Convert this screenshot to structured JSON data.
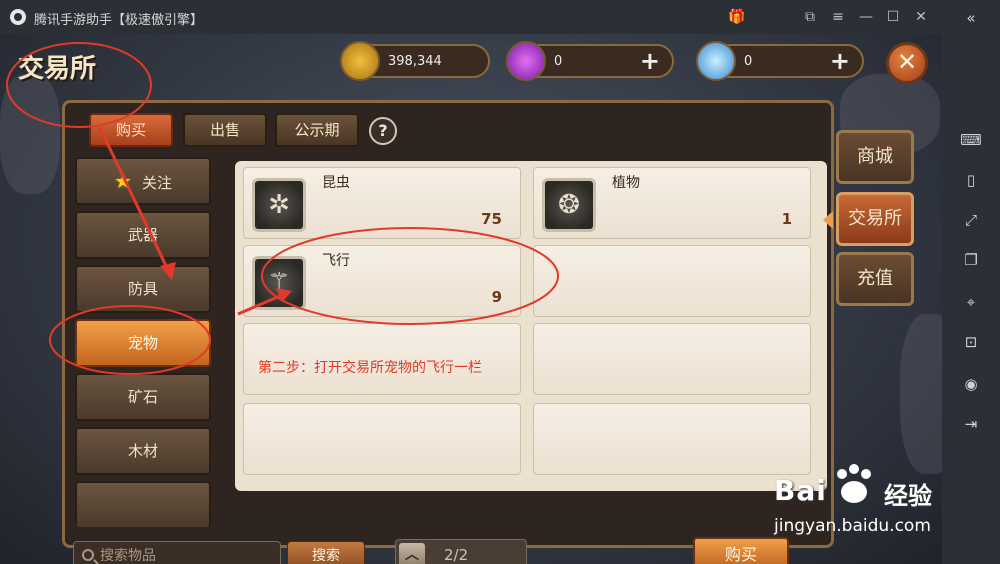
{
  "titlebar": {
    "title": "腾讯手游助手【极速傲引擎】",
    "buttons": [
      "gift-icon",
      "restore-icon",
      "menu-icon",
      "minimize-icon",
      "maximize-icon",
      "close-icon"
    ]
  },
  "emulator_sidebar": {
    "icons": [
      "collapse-icon",
      "keyboard-icon",
      "shake-icon",
      "fullscreen-icon",
      "multi-window-icon",
      "locate-icon",
      "screenshot-icon",
      "record-icon",
      "exit-icon"
    ]
  },
  "page": {
    "title": "交易所"
  },
  "currency": [
    {
      "icon": "gold-coin-icon",
      "value": "398,344",
      "color": "#e0a828",
      "has_plus": false
    },
    {
      "icon": "purple-gem-icon",
      "value": "0",
      "color": "#b04ad8",
      "has_plus": true
    },
    {
      "icon": "diamond-icon",
      "value": "0",
      "color": "#7ac8f0",
      "has_plus": true
    }
  ],
  "top_tabs": [
    {
      "label": "购买",
      "active": true
    },
    {
      "label": "出售",
      "active": false
    },
    {
      "label": "公示期",
      "active": false
    }
  ],
  "help_label": "?",
  "categories": [
    {
      "label": "关注",
      "icon": "star-icon",
      "active": false
    },
    {
      "label": "武器",
      "active": false
    },
    {
      "label": "防具",
      "active": false
    },
    {
      "label": "宠物",
      "active": true
    },
    {
      "label": "矿石",
      "active": false
    },
    {
      "label": "木材",
      "active": false
    }
  ],
  "items": [
    {
      "name": "昆虫",
      "count": "75",
      "icon": "insect-icon"
    },
    {
      "name": "植物",
      "count": "1",
      "icon": "plant-icon"
    },
    {
      "name": "飞行",
      "count": "9",
      "icon": "flying-icon"
    }
  ],
  "bottom": {
    "search_placeholder": "搜索物品",
    "search_button": "搜索",
    "page_indicator": "2/2",
    "buy_button": "购买"
  },
  "side_tabs": [
    {
      "label": "商城",
      "active": false
    },
    {
      "label": "交易所",
      "active": true
    },
    {
      "label": "充值",
      "active": false
    }
  ],
  "annotation": {
    "text": "第二步：打开交易所宠物的飞行一栏",
    "color": "#e23a2a"
  },
  "watermark": {
    "brand": "Bai",
    "brand_suffix": "经验",
    "url": "jingyan.baidu.com"
  }
}
